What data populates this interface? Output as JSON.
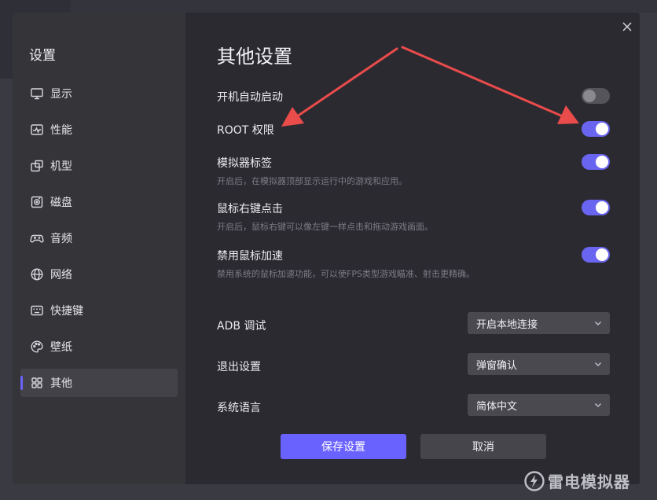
{
  "sidebar": {
    "title": "设置",
    "items": [
      {
        "label": "显示",
        "icon": "monitor-icon"
      },
      {
        "label": "性能",
        "icon": "performance-icon"
      },
      {
        "label": "机型",
        "icon": "device-model-icon"
      },
      {
        "label": "磁盘",
        "icon": "disk-icon"
      },
      {
        "label": "音频",
        "icon": "gamepad-icon"
      },
      {
        "label": "网络",
        "icon": "globe-icon"
      },
      {
        "label": "快捷键",
        "icon": "keyboard-icon"
      },
      {
        "label": "壁纸",
        "icon": "palette-icon"
      },
      {
        "label": "其他",
        "icon": "grid-icon",
        "active": true
      }
    ]
  },
  "content": {
    "title": "其他设置",
    "toggles": [
      {
        "label": "开机自动启动",
        "on": false
      },
      {
        "label": "ROOT 权限",
        "on": true
      },
      {
        "label": "模拟器标签",
        "desc": "开启后，在模拟器顶部显示运行中的游戏和应用。",
        "on": true
      },
      {
        "label": "鼠标右键点击",
        "desc": "开启后，鼠标右键可以像左键一样点击和拖动游戏画面。",
        "on": true
      },
      {
        "label": "禁用鼠标加速",
        "desc": "禁用系统的鼠标加速功能，可以使FPS类型游戏瞄准、射击更精确。",
        "on": true
      }
    ],
    "selects": [
      {
        "label": "ADB 调试",
        "value": "开启本地连接"
      },
      {
        "label": "退出设置",
        "value": "弹窗确认"
      },
      {
        "label": "系统语言",
        "value": "简体中文"
      }
    ],
    "save_label": "保存设置",
    "cancel_label": "取消"
  },
  "watermark": {
    "text": "雷电模拟器"
  },
  "colors": {
    "accent": "#6a62ff",
    "annotation_arrow": "#ea4b4b",
    "dialog_bg": "#2b2a31",
    "sidebar_bg": "#353439"
  }
}
